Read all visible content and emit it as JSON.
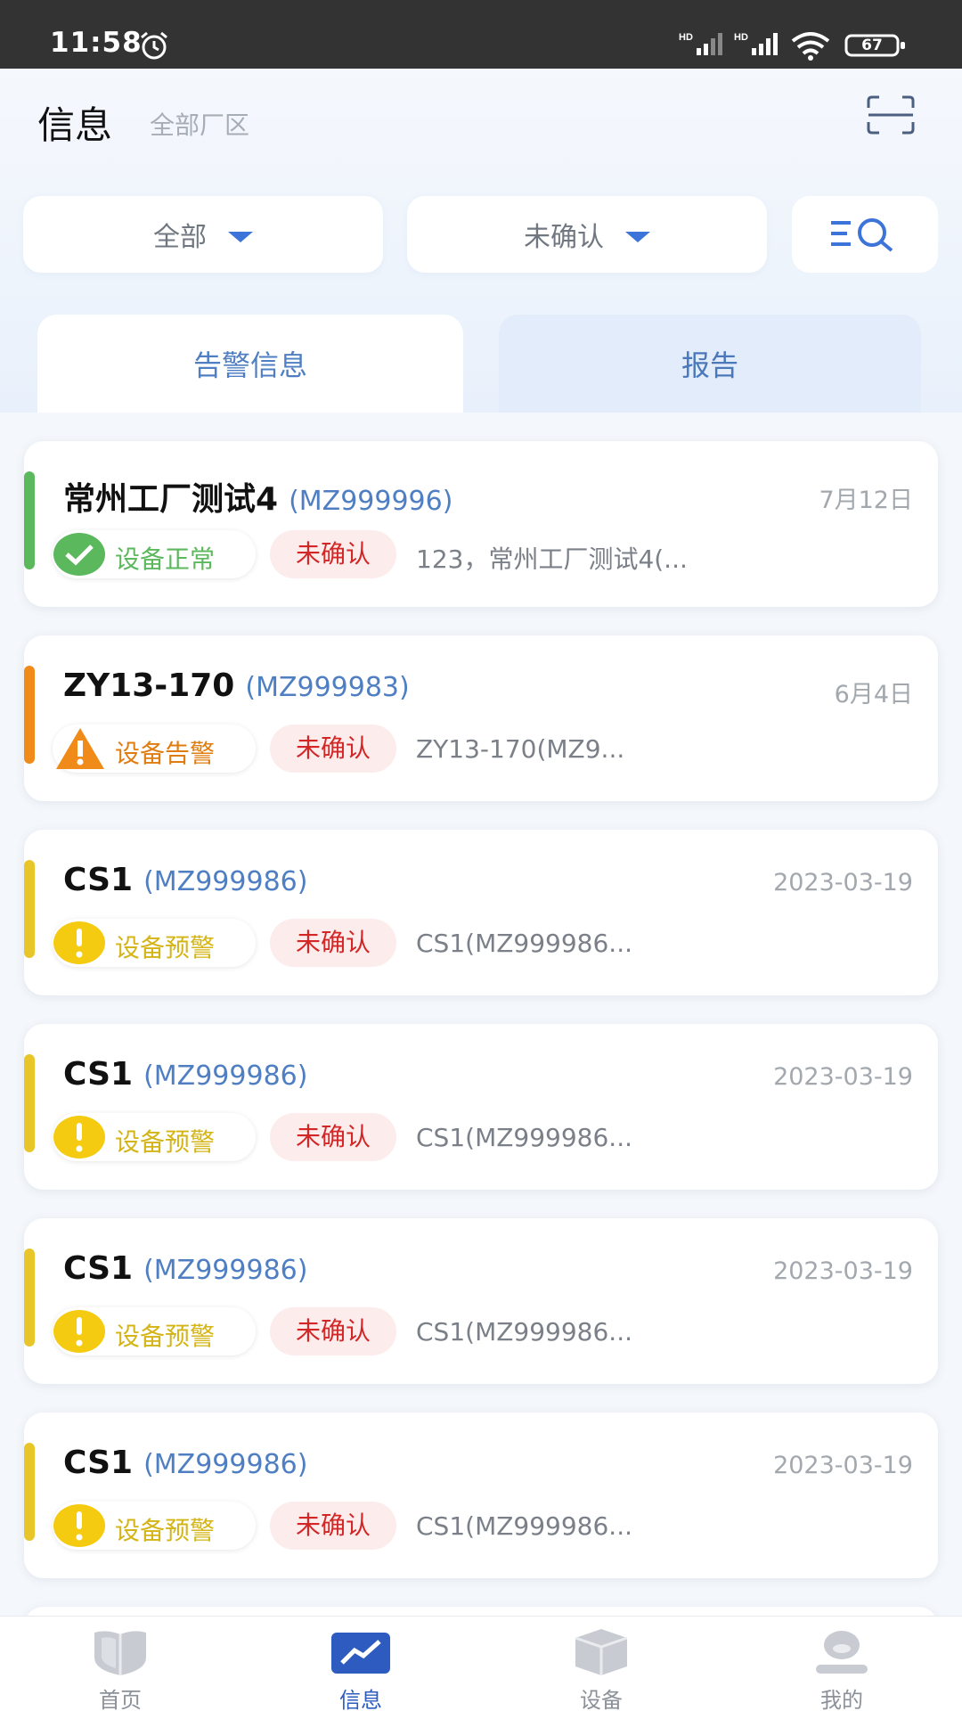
{
  "status_bar": {
    "time": "11:58",
    "battery": "67"
  },
  "header": {
    "title": "信息",
    "subtitle": "全部厂区"
  },
  "filters": [
    {
      "label": "全部"
    },
    {
      "label": "未确认"
    }
  ],
  "tabs": [
    {
      "label": "告警信息"
    },
    {
      "label": "报告"
    }
  ],
  "colors": {
    "normal": "#5cb85c",
    "alarm": "#f08a19",
    "warning": "#e8c62a",
    "accent": "#2d5bbf",
    "unconfirmed": "#d32626"
  },
  "cards": [
    {
      "name": "常州工厂测试4",
      "code": "(MZ999996)",
      "date": "7月12日",
      "status": "设备正常",
      "status_type": "normal",
      "confirm": "未确认",
      "desc": "123，常州工厂测试4(..."
    },
    {
      "name": "ZY13-170",
      "code": "(MZ999983)",
      "date": "6月4日",
      "status": "设备告警",
      "status_type": "alarm",
      "confirm": "未确认",
      "desc": "ZY13-170(MZ9..."
    },
    {
      "name": "CS1",
      "code": "(MZ999986)",
      "date": "2023-03-19",
      "status": "设备预警",
      "status_type": "warning",
      "confirm": "未确认",
      "desc": "CS1(MZ999986..."
    },
    {
      "name": "CS1",
      "code": "(MZ999986)",
      "date": "2023-03-19",
      "status": "设备预警",
      "status_type": "warning",
      "confirm": "未确认",
      "desc": "CS1(MZ999986..."
    },
    {
      "name": "CS1",
      "code": "(MZ999986)",
      "date": "2023-03-19",
      "status": "设备预警",
      "status_type": "warning",
      "confirm": "未确认",
      "desc": "CS1(MZ999986..."
    },
    {
      "name": "CS1",
      "code": "(MZ999986)",
      "date": "2023-03-19",
      "status": "设备预警",
      "status_type": "warning",
      "confirm": "未确认",
      "desc": "CS1(MZ999986..."
    }
  ],
  "bottom_nav": [
    {
      "label": "首页",
      "icon": "home-shield-icon"
    },
    {
      "label": "信息",
      "icon": "info-chart-icon",
      "active": true
    },
    {
      "label": "设备",
      "icon": "device-box-icon"
    },
    {
      "label": "我的",
      "icon": "profile-icon"
    }
  ]
}
